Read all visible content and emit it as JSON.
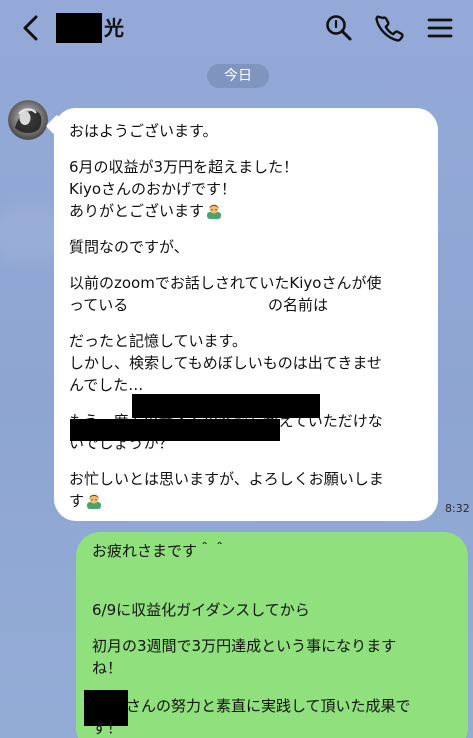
{
  "header": {
    "title_suffix": "光"
  },
  "date_label": "今日",
  "incoming_message": {
    "lines": [
      "おはようございます。",
      "",
      "6月の収益が3万円を超えました！",
      "Kiyoさんのおかげです！",
      "ありがとございます",
      "",
      "質問なのですが、",
      "",
      "以前のzoomでお話しされていたKiyoさんが使",
      "っている",
      "の名前は",
      "だったと記憶しています。",
      "しかし、検索してもめぼしいものは出てきませ",
      "んでした…",
      "",
      "もう一度そのサイトの名前を教えていただけな",
      "いでしょうか？",
      "",
      "お忙しいとは思いますが、よろしくお願いしま",
      "す"
    ],
    "time": "8:32"
  },
  "outgoing_message": {
    "lines": [
      "お疲れさまです＾＾",
      "",
      "",
      "6/9に収益化ガイダンスしてから",
      "",
      "初月の3週間で3万円達成という事になります",
      "ね！",
      "",
      "さんの努力と素直に実践して頂いた成果で",
      "す！"
    ]
  },
  "icons": {
    "back": "chevron-left-icon",
    "search": "search-icon",
    "call": "phone-icon",
    "menu": "hamburger-menu-icon",
    "avatar": "profile-avatar",
    "emoji": "bowing-person-emoji"
  },
  "colors": {
    "background": "#8fa7d4",
    "incoming_bubble": "#ffffff",
    "outgoing_bubble": "#90e07d",
    "date_pill": "#7f95bf"
  }
}
